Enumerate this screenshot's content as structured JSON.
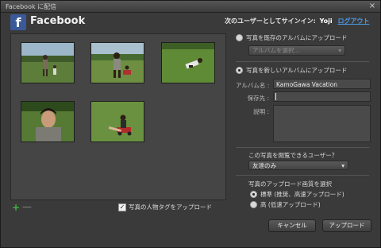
{
  "window": {
    "title": "Facebook に配信",
    "close_glyph": "×"
  },
  "header": {
    "logo_glyph": "f",
    "service_name": "Facebook",
    "signin_prefix": "次のユーザーとしてサインイン:",
    "user_name": "Yoji",
    "logout_link": "ログアウト"
  },
  "gallery": {
    "thumbnails": [
      {
        "scene": "person-walking-with-child"
      },
      {
        "scene": "person-running-with-toy-car"
      },
      {
        "scene": "child-lying-on-grass"
      },
      {
        "scene": "person-smiling-closeup"
      },
      {
        "scene": "child-riding-toy-car"
      }
    ],
    "add_icon": "+",
    "remove_icon": "—",
    "tag_checkbox_label": "写真の人物タグをアップロード",
    "tag_checkbox_checked": true
  },
  "album": {
    "existing_radio_label": "写真を既存のアルバムにアップロード",
    "existing_select_placeholder": "アルバムを選択...",
    "new_radio_label": "写真を新しいアルバムにアップロード",
    "selected": "new",
    "name_label": "アルバム名 :",
    "name_value": "KamoGawa Vacation",
    "location_label": "保存先 :",
    "location_value": "",
    "description_label": "説明 :",
    "description_value": ""
  },
  "privacy": {
    "label": "この写真を閲覧できるユーザー？",
    "selected": "友達のみ"
  },
  "quality": {
    "section_title": "写真のアップロード画質を選択",
    "options": [
      {
        "label": "標準 (推奨、高速アップロード)",
        "checked": true
      },
      {
        "label": "高 (低速アップロード)",
        "checked": false
      }
    ]
  },
  "actions": {
    "cancel": "キャンセル",
    "upload": "アップロード"
  },
  "colors": {
    "accent_link": "#4c9ae8",
    "facebook_blue": "#3b5998",
    "add_green": "#3fb23f"
  }
}
